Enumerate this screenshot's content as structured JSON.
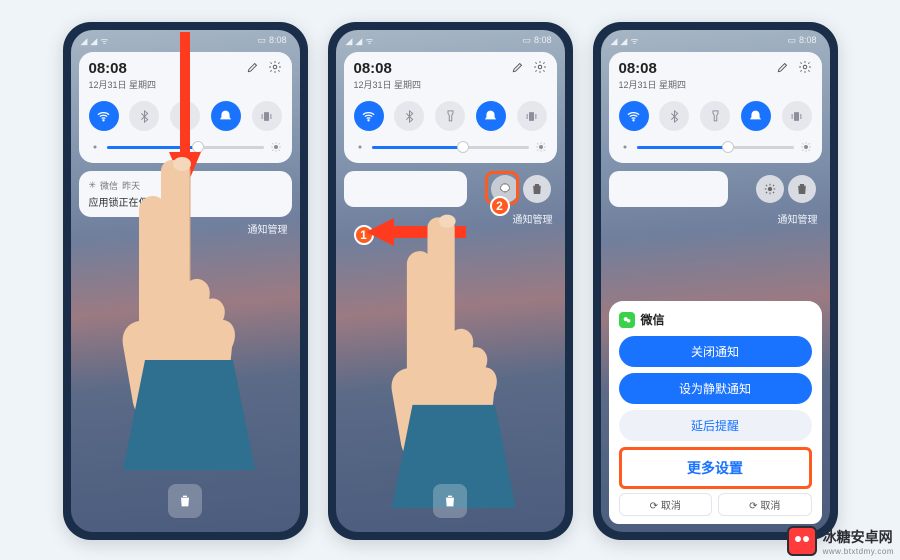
{
  "statusbar": {
    "time": "8:08"
  },
  "panel": {
    "time": "08:08",
    "date": "12月31日 星期四"
  },
  "notification": {
    "app": "微信",
    "when": "昨天",
    "body": "应用锁正在保护"
  },
  "notif_manage": "通知管理",
  "callouts": {
    "one": "1",
    "two": "2"
  },
  "sheet": {
    "app": "微信",
    "close": "关闭通知",
    "silent": "设为静默通知",
    "snooze": "延后提醒",
    "more": "更多设置",
    "cancel": "取消"
  },
  "watermark": {
    "name": "冰糖安卓网",
    "url": "www.btxtdmy.com"
  },
  "colors": {
    "accent": "#1a73ff",
    "highlight": "#ff5a1f"
  }
}
